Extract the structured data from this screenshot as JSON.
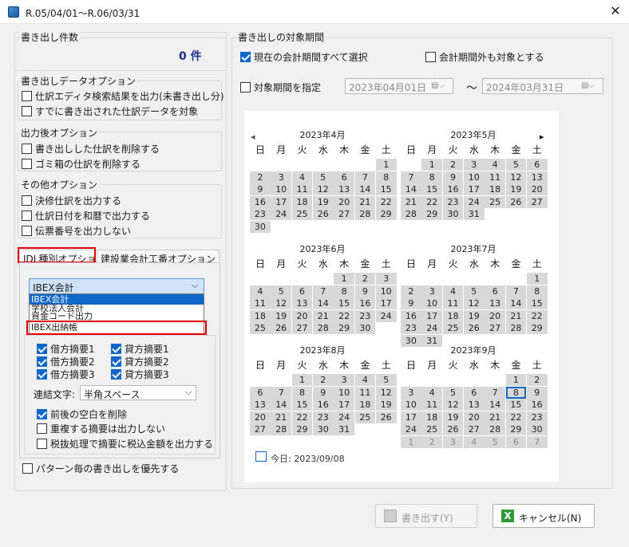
{
  "window": {
    "title": "R.05/04/01〜R.06/03/31",
    "close": "✕"
  },
  "export_count": {
    "group": "書き出し件数",
    "value": "0 件"
  },
  "data_options": {
    "group": "書き出しデータオプション",
    "items": [
      "仕訳エディタ検索結果を出力(未書き出し分)",
      "すでに書き出された仕訳データを対象"
    ]
  },
  "after_options": {
    "group": "出力後オプション",
    "items": [
      "書き出しした仕訳を削除する",
      "ゴミ箱の仕訳を削除する"
    ]
  },
  "other_options": {
    "group": "その他オプション",
    "items": [
      "決修仕訳を出力する",
      "仕訳日付を和暦で出力する",
      "伝票番号を出力しない"
    ]
  },
  "tabs": [
    "JDL種別オプション",
    "建設業会計工番オプション"
  ],
  "jdl_type": {
    "selected": "IBEX会計",
    "options": [
      "IBEX会計",
      "学校法人会計",
      "資金コード出力",
      "IBEX出納帳"
    ]
  },
  "summary": {
    "items": [
      {
        "label": "借方摘要1",
        "checked": true
      },
      {
        "label": "貸方摘要1",
        "checked": true
      },
      {
        "label": "借方摘要2",
        "checked": true
      },
      {
        "label": "貸方摘要2",
        "checked": true
      },
      {
        "label": "借方摘要3",
        "checked": true
      },
      {
        "label": "貸方摘要3",
        "checked": true
      }
    ],
    "concat_label": "連結文字:",
    "concat_value": "半角スペース",
    "trim": "前後の空白を削除",
    "dup": "重複する摘要は出力しない",
    "tax": "税抜処理で摘要に税込金額を出力する"
  },
  "pattern_priority": "パターン毎の書き出しを優先する",
  "period": {
    "group": "書き出しの対象期間",
    "all_current": "現在の会計期間すべて選択",
    "outside": "会計期間外も対象とする",
    "specify": "対象期間を指定",
    "from": "2023年04月01日",
    "to": "2024年03月31日",
    "tilde": "〜"
  },
  "calendar": {
    "dow": [
      "日",
      "月",
      "火",
      "水",
      "木",
      "金",
      "土"
    ],
    "prev": "◂",
    "next": "▸",
    "months": [
      {
        "title": "2023年4月",
        "offset": 6,
        "days": 30,
        "trail": 0
      },
      {
        "title": "2023年5月",
        "offset": 1,
        "days": 31,
        "trail": 0
      },
      {
        "title": "2023年6月",
        "offset": 4,
        "days": 30,
        "trail": 0
      },
      {
        "title": "2023年7月",
        "offset": 6,
        "days": 31,
        "trail": 0
      },
      {
        "title": "2023年8月",
        "offset": 2,
        "days": 31,
        "trail": 0
      },
      {
        "title": "2023年9月",
        "offset": 5,
        "days": 30,
        "trail": 7
      }
    ],
    "today": "今日: 2023/09/08",
    "today_day": 8
  },
  "buttons": {
    "export": "書き出す(Y)",
    "cancel": "キャンセル(N)"
  }
}
